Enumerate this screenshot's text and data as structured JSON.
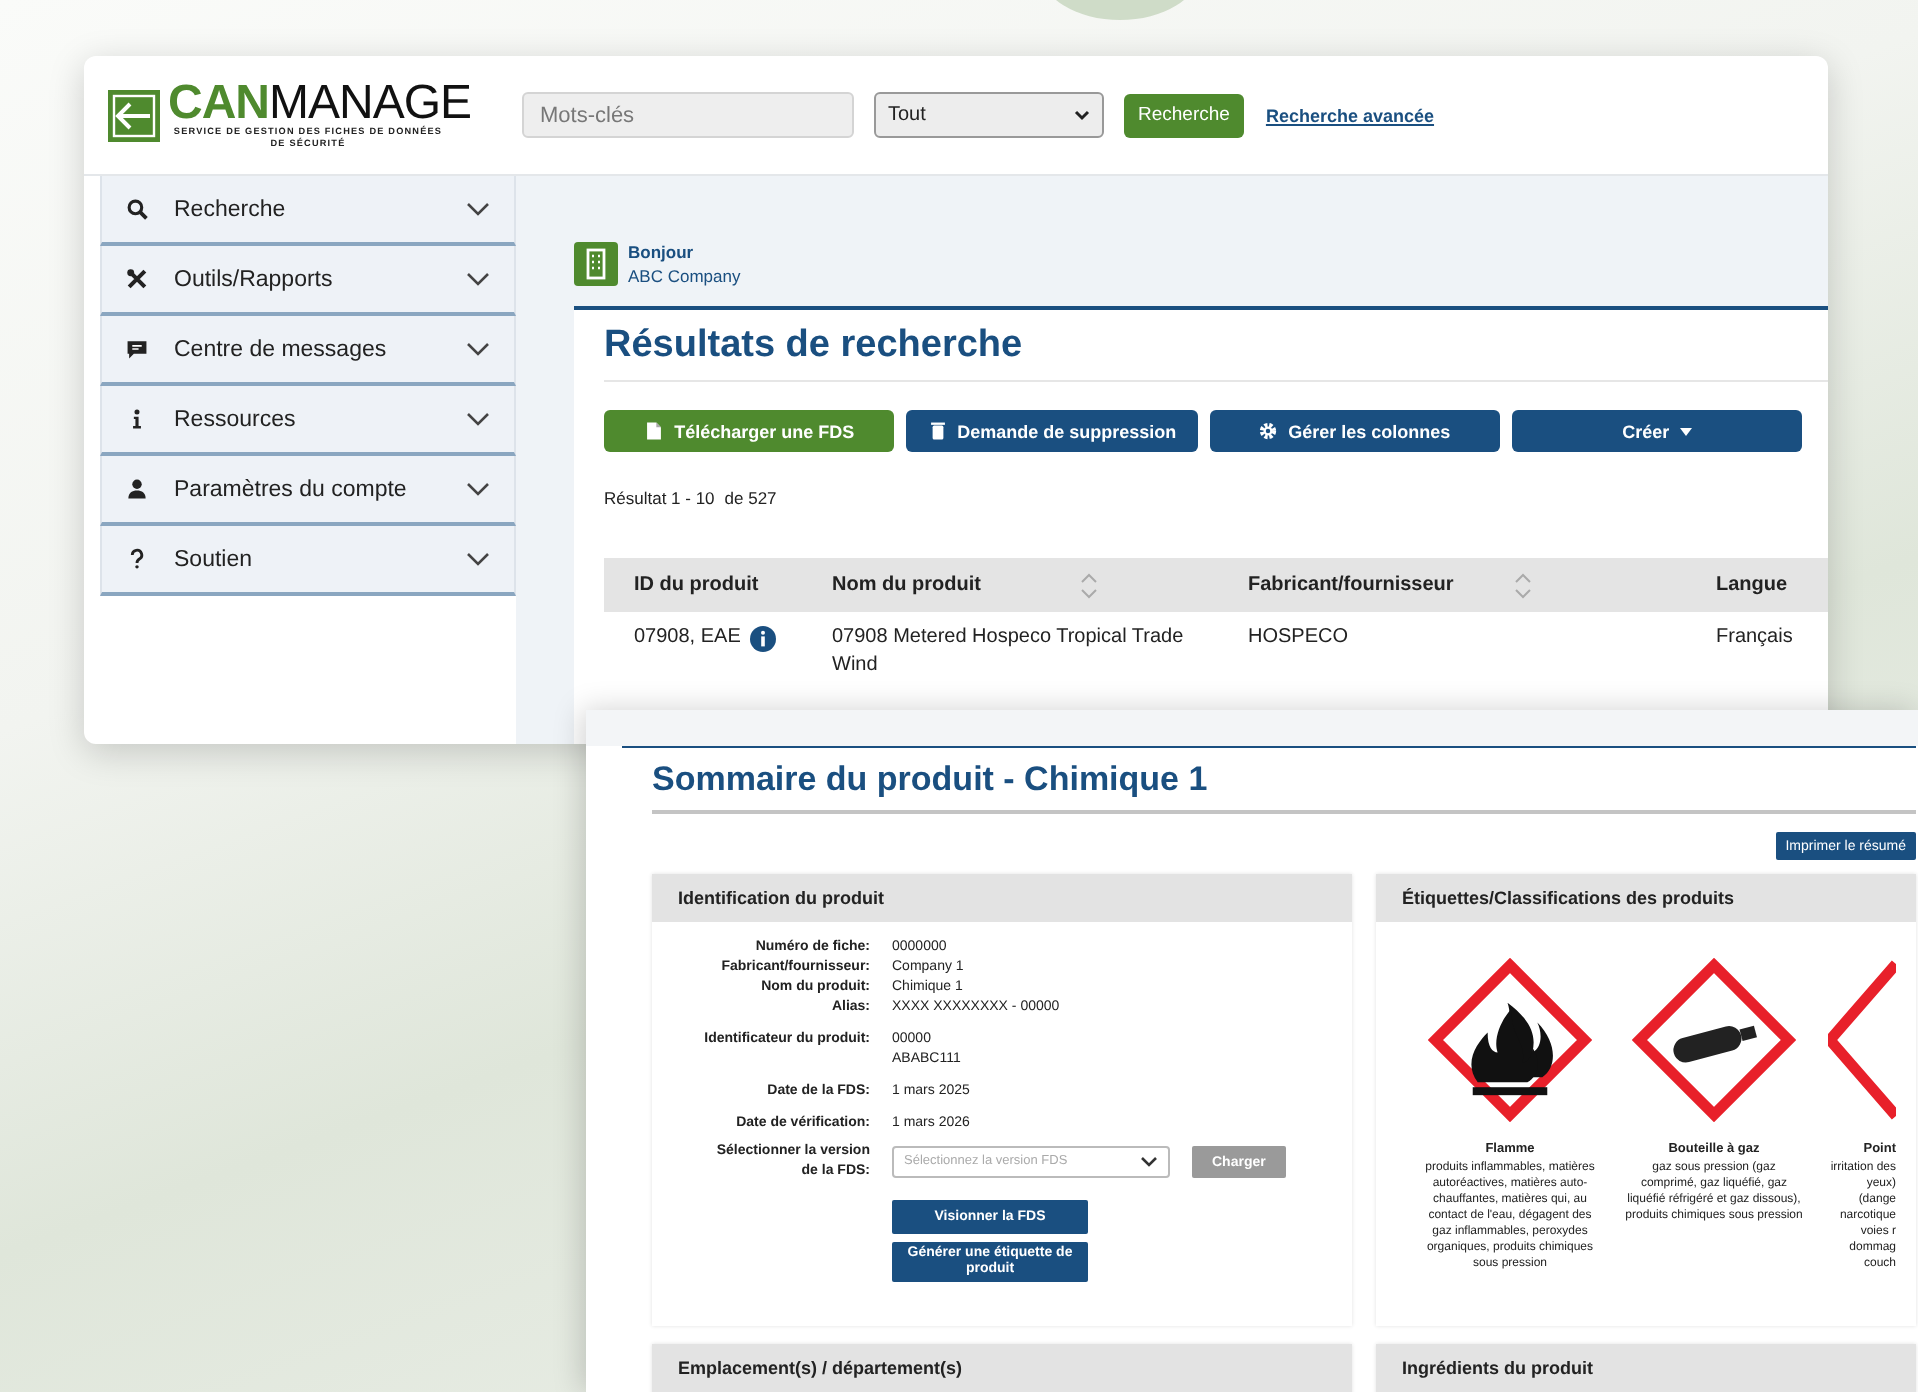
{
  "logo": {
    "brand_bold": "CAN",
    "brand_light": "MANAGE",
    "tagline": "SERVICE DE GESTION DES FICHES DE DONNÉES DE SÉCURITÉ"
  },
  "header": {
    "search": {
      "placeholder": "Mots-clés"
    },
    "filter": {
      "value": "Tout"
    },
    "search_button": "Recherche",
    "advanced_link": "Recherche avancée"
  },
  "sidebar": {
    "items": [
      {
        "kind": "search",
        "label": "Recherche",
        "expanded": false
      },
      {
        "kind": "tools",
        "label": "Outils/Rapports",
        "expanded": false
      },
      {
        "kind": "message",
        "label": "Centre de messages",
        "expanded": false
      },
      {
        "kind": "info",
        "label": "Ressources",
        "expanded": false
      },
      {
        "kind": "user",
        "label": "Paramètres du compte",
        "expanded": false
      },
      {
        "kind": "help",
        "label": "Soutien",
        "expanded": false
      }
    ]
  },
  "greeting": {
    "title": "Bonjour",
    "company": "ABC Company"
  },
  "results": {
    "title": "Résultats de recherche",
    "actions": [
      {
        "kind": "download",
        "label": "Télécharger une FDS"
      },
      {
        "kind": "delete",
        "label": "Demande de suppression"
      },
      {
        "kind": "settings",
        "label": "Gérer les colonnes"
      },
      {
        "kind": "dropdown",
        "label": "Créer"
      }
    ],
    "count_range": "Résultat 1 - 10",
    "count_total": "de 527",
    "table": {
      "columns": [
        {
          "label": "ID du produit",
          "sortable": false
        },
        {
          "label": "Nom du produit",
          "sortable": true
        },
        {
          "label": "Fabricant/fournisseur",
          "sortable": true
        },
        {
          "label": "Langue",
          "sortable": false
        }
      ],
      "rows": [
        {
          "cells": [
            "07908, EAE",
            "07908 Metered Hospeco Tropical Trade Wind",
            "HOSPECO",
            "Français"
          ],
          "info": true
        }
      ]
    }
  },
  "product_summary": {
    "title": "Sommaire du produit - Chimique 1",
    "print_button": "Imprimer le résumé",
    "identification": {
      "title": "Identification du produit",
      "field_groups": [
        [
          {
            "label": "Numéro de fiche:",
            "values": [
              "0000000"
            ]
          },
          {
            "label": "Fabricant/fournisseur:",
            "values": [
              "Company 1"
            ]
          },
          {
            "label": "Nom du produit:",
            "values": [
              "Chimique 1"
            ]
          },
          {
            "label": "Alias:",
            "values": [
              "XXXX XXXXXXXX - 00000"
            ]
          }
        ],
        [
          {
            "label": "Identificateur du produit:",
            "values": [
              "00000",
              "ABABC111"
            ]
          }
        ],
        [
          {
            "label": "Date de la FDS:",
            "values": [
              "1 mars 2025"
            ]
          }
        ],
        [
          {
            "label": "Date de vérification:",
            "values": [
              "1 mars 2026"
            ]
          }
        ]
      ],
      "version": {
        "label": "Sélectionner la version de la FDS:",
        "placeholder": "Sélectionnez la version FDS",
        "load_button": "Charger",
        "load_disabled": true
      },
      "buttons": [
        "Visionner la FDS",
        "Générer une étiquette de produit"
      ]
    },
    "labels": {
      "title": "Étiquettes/Classifications des produits",
      "pictograms": [
        {
          "kind": "flame",
          "title": "Flamme",
          "description": "produits inflammables, matières autoréactives, matières auto-chauffantes, matières qui, au contact de l'eau, dégagent des gaz inflammables, peroxydes organiques, produits chimiques sous pression"
        },
        {
          "kind": "gas_cylinder",
          "title": "Bouteille à gaz",
          "description": "gaz sous pression (gaz comprimé, gaz liquéfié, gaz liquéfié réfrigéré et gaz dissous), produits chimiques sous pression"
        },
        {
          "kind": "partial",
          "title": "Point",
          "description": "irritation des yeux) (dange narcotique voies r dommag couch"
        }
      ]
    },
    "location": {
      "title": "Emplacement(s) / département(s)"
    },
    "ingredients": {
      "title": "Ingrédients du produit"
    }
  }
}
